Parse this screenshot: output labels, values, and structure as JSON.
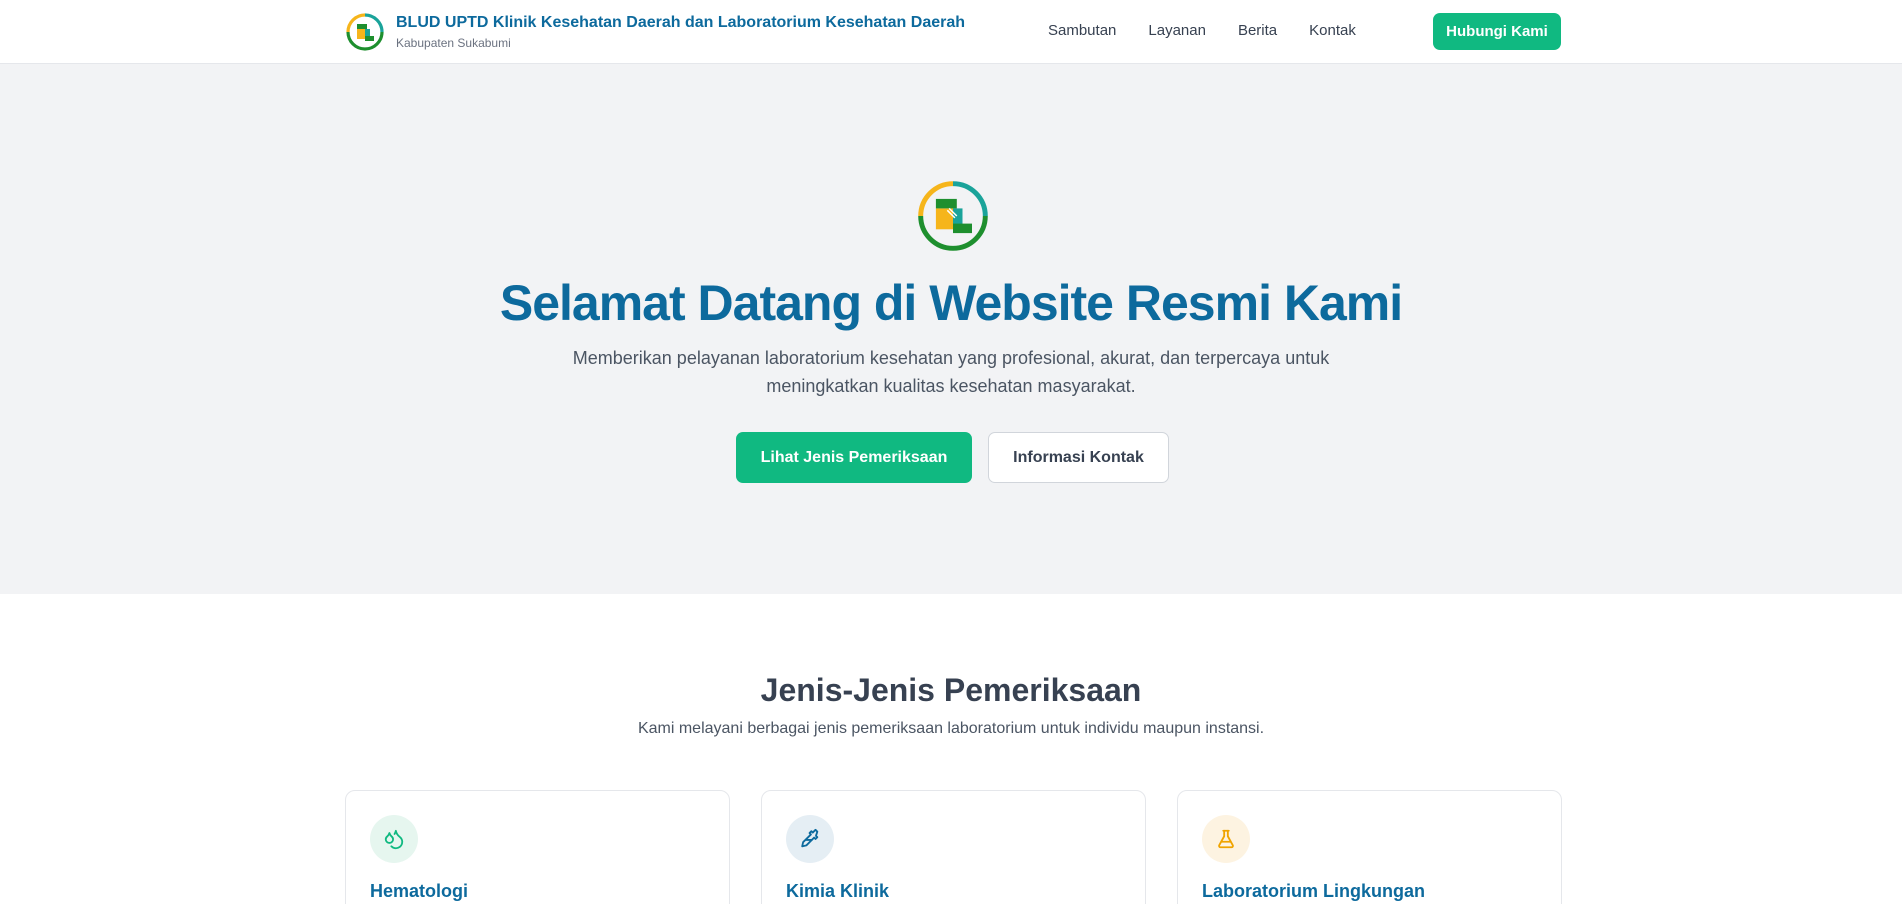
{
  "header": {
    "title": "BLUD UPTD Klinik Kesehatan Daerah dan Laboratorium Kesehatan Daerah",
    "subtitle": "Kabupaten Sukabumi",
    "logo_icon": "clinic-logo-icon",
    "nav": [
      {
        "label": "Sambutan"
      },
      {
        "label": "Layanan"
      },
      {
        "label": "Berita"
      },
      {
        "label": "Kontak"
      }
    ],
    "cta_label": "Hubungi Kami"
  },
  "hero": {
    "title": "Selamat Datang di Website Resmi Kami",
    "description": "Memberikan pelayanan laboratorium kesehatan yang profesional, akurat, dan terpercaya untuk meningkatkan kualitas kesehatan masyarakat.",
    "primary_button": "Lihat Jenis Pemeriksaan",
    "secondary_button": "Informasi Kontak"
  },
  "services": {
    "title": "Jenis-Jenis Pemeriksaan",
    "subtitle": "Kami melayani berbagai jenis pemeriksaan laboratorium untuk individu maupun instansi.",
    "cards": [
      {
        "title": "Hematologi",
        "icon": "droplets-icon"
      },
      {
        "title": "Kimia Klinik",
        "icon": "pipette-icon"
      },
      {
        "title": "Laboratorium Lingkungan",
        "icon": "flask-icon"
      }
    ]
  },
  "colors": {
    "brand_blue": "#0d6a9d",
    "brand_green": "#10b981",
    "hero_bg": "#f2f3f5",
    "logo_yellow": "#f6b51b",
    "logo_teal": "#1aa39a",
    "logo_green": "#1e8f2e"
  }
}
